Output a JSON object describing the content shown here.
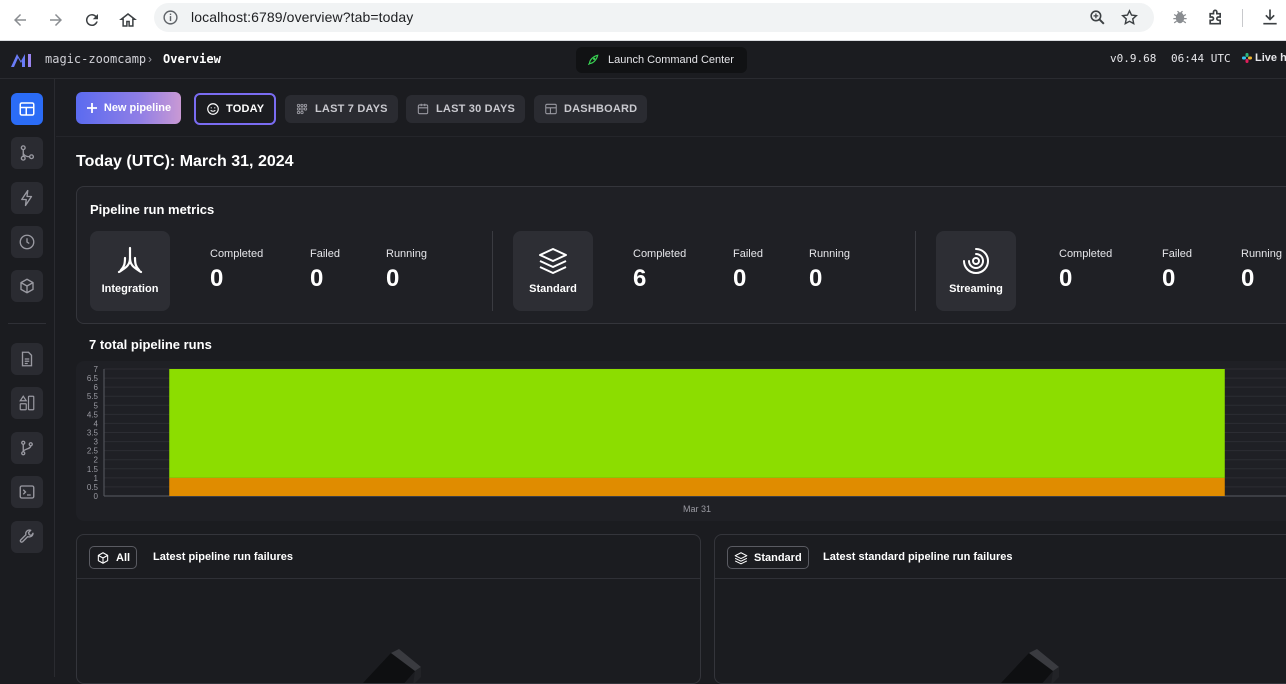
{
  "browser": {
    "url": "localhost:6789/overview?tab=today"
  },
  "header": {
    "project": "magic-zoomcamp",
    "separator": "›",
    "page": "Overview",
    "command_center": "Launch Command Center",
    "version": "v0.9.68",
    "time": "06:44 UTC",
    "live": "Live he"
  },
  "toolbar": {
    "new_pipeline": "New pipeline",
    "tabs": [
      "TODAY",
      "LAST 7 DAYS",
      "LAST 30 DAYS",
      "DASHBOARD"
    ]
  },
  "page_title": "Today (UTC): March 31, 2024",
  "metrics": {
    "title": "Pipeline run metrics",
    "groups": [
      {
        "type": "Integration",
        "completed_label": "Completed",
        "completed": "0",
        "failed_label": "Failed",
        "failed": "0",
        "running_label": "Running",
        "running": "0"
      },
      {
        "type": "Standard",
        "completed_label": "Completed",
        "completed": "6",
        "failed_label": "Failed",
        "failed": "0",
        "running_label": "Running",
        "running": "0"
      },
      {
        "type": "Streaming",
        "completed_label": "Completed",
        "completed": "0",
        "failed_label": "Failed",
        "failed": "0",
        "running_label": "Running",
        "running": "0"
      }
    ]
  },
  "runs_title": "7 total pipeline runs",
  "chart_data": {
    "type": "bar",
    "stacked": true,
    "categories": [
      "Mar 31"
    ],
    "series": [
      {
        "values": [
          1
        ],
        "color": "#e08c00"
      },
      {
        "values": [
          6
        ],
        "color": "#8cdd00"
      }
    ],
    "ylim": [
      0,
      7
    ],
    "yticks": [
      "0",
      "0.5",
      "1",
      "1.5",
      "2",
      "2.5",
      "3",
      "3.5",
      "4",
      "4.5",
      "5",
      "5.5",
      "6",
      "6.5",
      "7"
    ],
    "grid": true
  },
  "failures": [
    {
      "tag": "All",
      "title": "Latest pipeline run failures"
    },
    {
      "tag": "Standard",
      "title": "Latest standard pipeline run failures"
    }
  ],
  "colors": {
    "accent": "#2b6cf6",
    "active_tab_border": "#7a6cf2",
    "bar_completed": "#8cdd00",
    "bar_other": "#e08c00"
  }
}
